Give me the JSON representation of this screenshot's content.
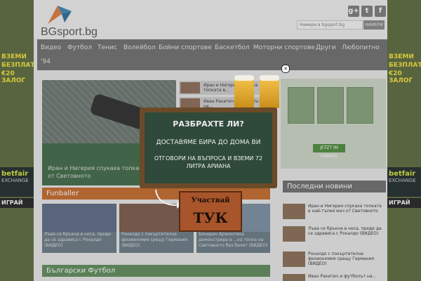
{
  "side_ad": {
    "line1": "ВЗЕМИ",
    "line2": "БЕЗПЛАТ...",
    "line3": "€20 ЗАЛОГ",
    "brand": "betfair",
    "brand_sub": "EXCHANGE",
    "play": "ИГРАЙ"
  },
  "header": {
    "logo_text": "BGsport.bg",
    "search_placeholder": "Намери в bgsport.bg",
    "search_button": "НАМЕРИ",
    "social": [
      "g+",
      "t",
      "f"
    ]
  },
  "nav": {
    "items": [
      "Видео",
      "Футбол",
      "Тенис",
      "Волейбол",
      "Бойни спортове",
      "Баскетбол",
      "Моторни спортове",
      "Други",
      "Любопитно",
      "'94"
    ]
  },
  "hero": {
    "caption": "Иран и Нигерия спукаха топката в мач от Световното"
  },
  "strips": [
    {
      "label": "Иран и Нигерия спукаха топката в..."
    },
    {
      "label": "Иван Ракитич и футболът на..."
    }
  ],
  "sections": {
    "funballer": "Funballer",
    "bg_football": "Български Футбол",
    "latest": "Последни новини"
  },
  "cards": [
    {
      "caption": "Лъва се бръкна в носа, преди да се здрависа с Роналдо (ВИДЕО)"
    },
    {
      "caption": "Роналдо с покъртителна физиономия срещу Германия (ВИДЕО)"
    },
    {
      "caption": "Бинерен Аржентина демонстрира в ...на топка на Световното без билет (ВИДЕО)"
    }
  ],
  "ad": {
    "button": "JETZT IM HANDEL"
  },
  "latest_news": [
    {
      "title": "Иран и Нигерия спукаха топката в най-тъпия мач от Световното"
    },
    {
      "title": "Лъва се бръкна в носа, преди да се здрависа с Роналдо (ВИДЕО)"
    },
    {
      "title": "Роналдо с покъртителна физиономия срещу Германия (ВИДЕО)"
    },
    {
      "title": "Иван Ракитич и футболът на..."
    }
  ],
  "popup": {
    "title": "РАЗБРАХТЕ ЛИ?",
    "line2": "ДОСТАВЯМЕ БИРА ДО ДОМА ВИ",
    "line3": "ОТГОВОРИ НА ВЪПРОСА И ВЗЕМИ 72 ЛИТРА АРИАНА",
    "sign_top": "Участвай",
    "sign_bottom": "ТУК",
    "close": "✕"
  },
  "colors": {
    "nav": "#6e6e6e",
    "funballer_bar": "#c66a2a",
    "bg_football_bar": "#5f8b5a",
    "latest_bar": "#6e6e6e"
  }
}
